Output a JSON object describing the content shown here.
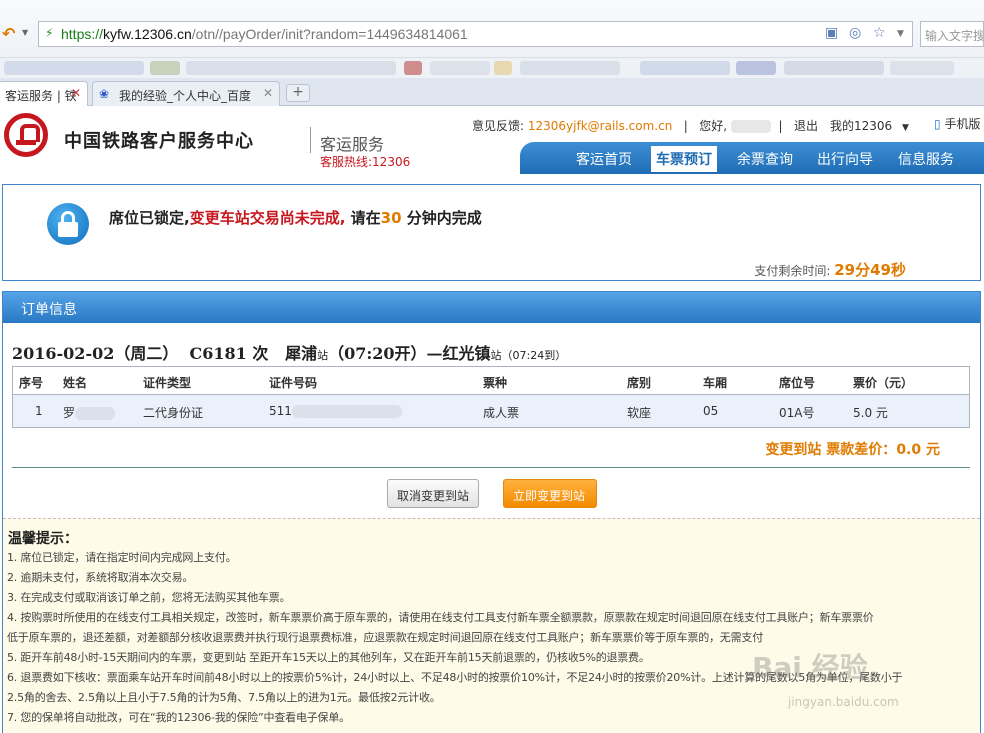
{
  "browser": {
    "url_scheme": "https://",
    "url_domain": "kyfw.12306.cn",
    "url_path": "/otn//payOrder/init?random=1449634814061",
    "search_placeholder": "输入文字搜",
    "tabs": [
      {
        "label": "客运服务 | 铁",
        "close": "✕"
      },
      {
        "label": "我的经验_个人中心_百度",
        "close": "✕"
      }
    ],
    "new_tab": "+"
  },
  "header": {
    "brand": "中国铁路客户服务中心",
    "brand_sub": "客运服务",
    "hotline": "客服热线:12306",
    "feedback_label": "意见反馈:",
    "feedback_email": "12306yjfk@rails.com.cn",
    "greeting": "您好,",
    "logout": "退出",
    "my12306": "我的12306",
    "mobile": "手机版",
    "nav": [
      "客运首页",
      "车票预订",
      "余票查询",
      "出行向导",
      "信息服务"
    ]
  },
  "notice": {
    "part1": "席位已锁定,",
    "part2": "变更车站交易尚未完成,",
    "part3": "请在",
    "minutes": "30",
    "part4": "分钟内完成",
    "remain_label": "支付剩余时间:",
    "remain_time": "29分49秒"
  },
  "order": {
    "title": "订单信息",
    "date": "2016-02-02（周二）",
    "train": "C6181 次",
    "from": "犀浦",
    "from_suffix": "站",
    "depart": "（07:20开）",
    "dash": "—",
    "to": "红光镇",
    "to_suffix": "站",
    "arrive": "（07:24到）",
    "columns": [
      "序号",
      "姓名",
      "证件类型",
      "证件号码",
      "票种",
      "席别",
      "车厢",
      "席位号",
      "票价（元）"
    ],
    "rows": [
      {
        "no": "1",
        "name": "罗",
        "id_type": "二代身份证",
        "id_no": "511",
        "ticket_type": "成人票",
        "seat_class": "软座",
        "car": "05",
        "seat": "01A号",
        "price": "5.0 元"
      }
    ],
    "diff_label": "变更到站 票款差价：",
    "diff_value": "0.0 元",
    "cancel_button": "取消变更到站",
    "confirm_button": "立即变更到站"
  },
  "tips": {
    "title": "温馨提示：",
    "items": [
      "1. 席位已锁定，请在指定时间内完成网上支付。",
      "2. 逾期未支付，系统将取消本次交易。",
      "3. 在完成支付或取消该订单之前，您将无法购买其他车票。",
      "4. 按购票时所使用的在线支付工具相关规定，改签时，新车票票价高于原车票的，请使用在线支付工具支付新车票全额票款，原票款在规定时间退回原在线支付工具账户；新车票票价",
      "低于原车票的，退还差额，对差额部分核收退票费并执行现行退票费标准，应退票款在规定时间退回原在线支付工具账户；新车票票价等于原车票的，无需支付",
      "5. 距开车前48小时-15天期间内的车票，变更到站 至距开车15天以上的其他列车，又在距开车前15天前退票的，仍核收5%的退票费。",
      "6. 退票费如下核收：票面乘车站开车时间前48小时以上的按票价5%计，24小时以上、不足48小时的按票价10%计，不足24小时的按票价20%计。上述计算的尾数以5角为单位，尾数小于",
      "2.5角的舍去、2.5角以上且小于7.5角的计为5角、7.5角以上的进为1元。最低按2元计收。",
      "7. 您的保单将自动批改，可在“我的12306-我的保险”中查看电子保单。"
    ]
  },
  "watermark": {
    "main": "Bai 经验",
    "sub": "jingyan.baidu.com"
  },
  "colors": {
    "brand_red": "#c7171e",
    "nav_blue": "#1f6cb3",
    "accent_orange": "#e07a00"
  }
}
